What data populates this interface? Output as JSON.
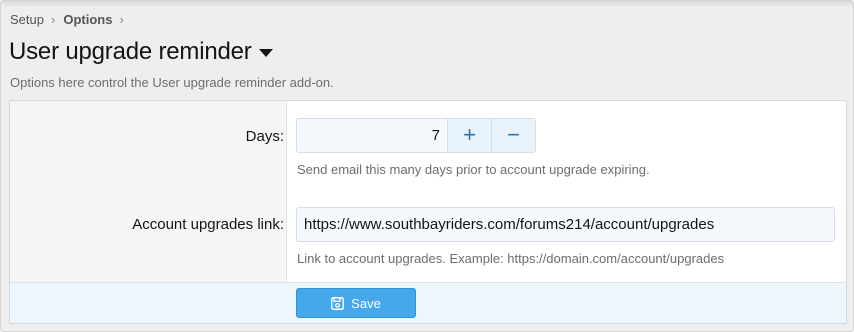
{
  "breadcrumb": {
    "items": [
      "Setup",
      "Options"
    ],
    "separator": "›"
  },
  "page": {
    "title": "User upgrade reminder",
    "description": "Options here control the User upgrade reminder add-on."
  },
  "form": {
    "days": {
      "label": "Days:",
      "value": "7",
      "increment": "+",
      "decrement": "−",
      "hint": "Send email this many days prior to account upgrade expiring."
    },
    "upgrades_link": {
      "label": "Account upgrades link:",
      "value": "https://www.southbayriders.com/forums214/account/upgrades",
      "hint": "Link to account upgrades. Example: https://domain.com/account/upgrades"
    },
    "save_label": "Save"
  },
  "icons": {
    "title_menu": "caret-down-icon",
    "save": "save-disk-icon"
  },
  "colors": {
    "accent": "#47a7eb",
    "footer_bg": "#edf6fd",
    "input_bg": "#f5f9fd",
    "spin_btn_bg": "#e8f2fb",
    "spin_btn_fg": "#2577b1"
  }
}
